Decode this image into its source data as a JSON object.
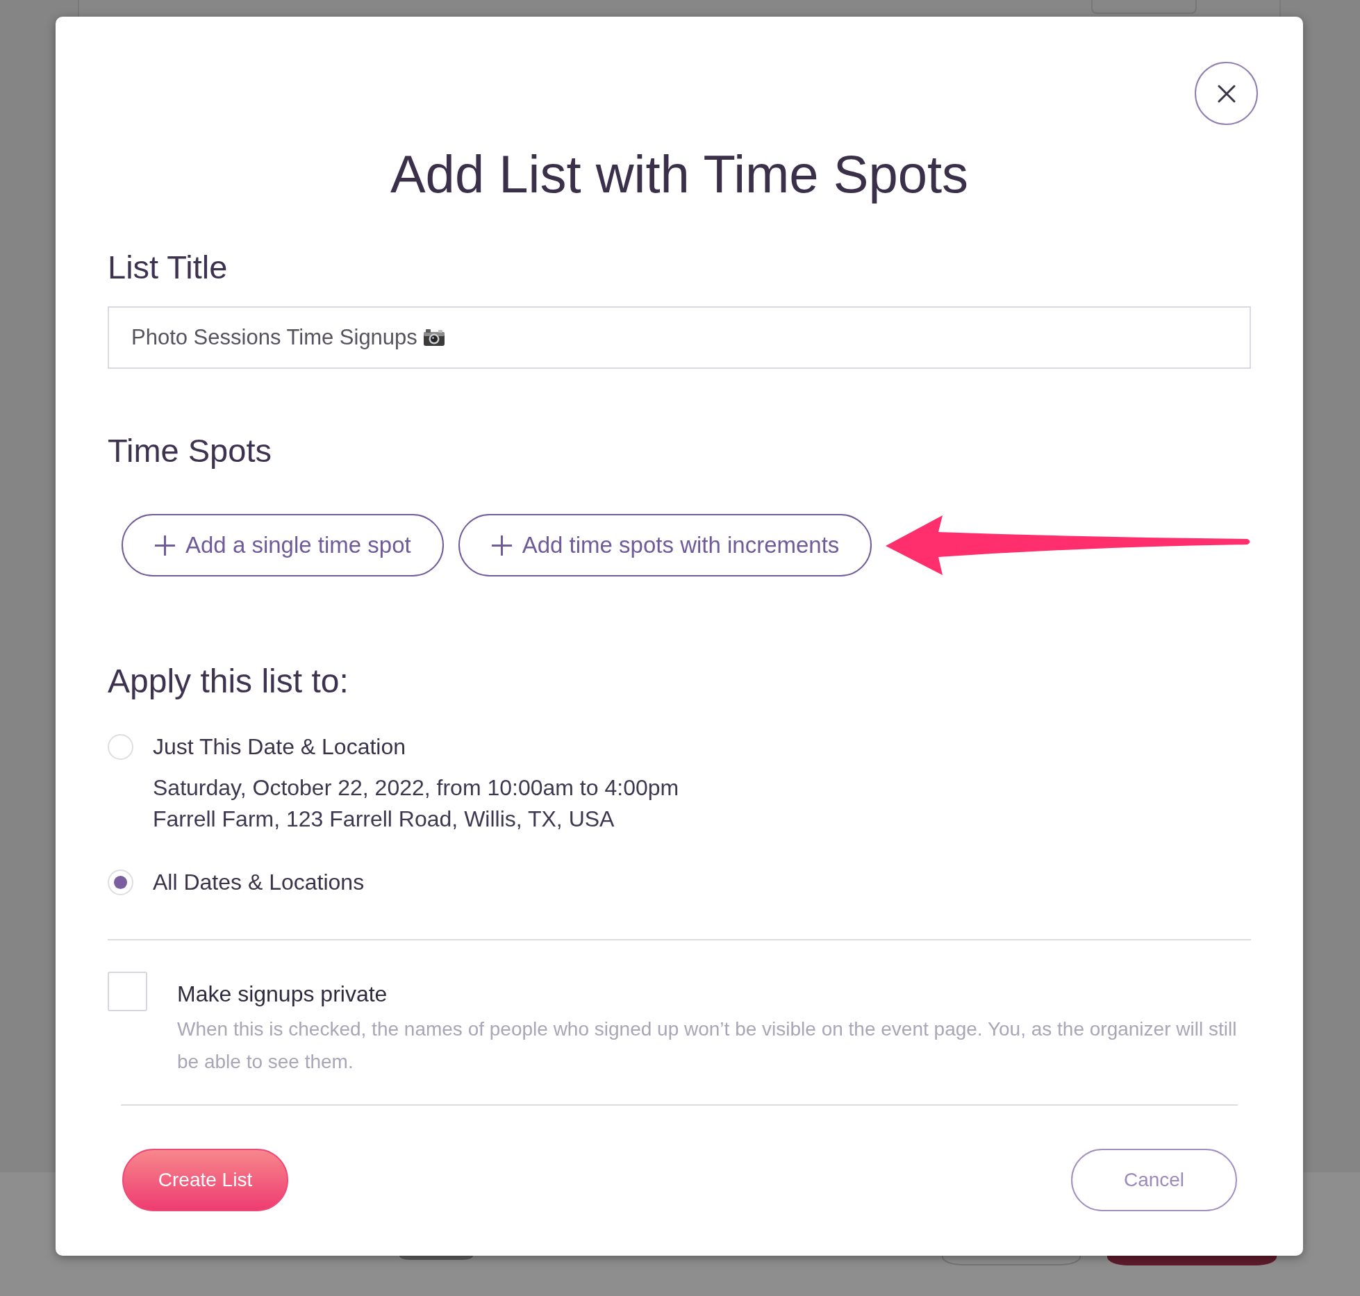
{
  "dialog": {
    "title": "Add List with Time Spots"
  },
  "list_title": {
    "label": "List Title",
    "value": "Photo Sessions Time Signups"
  },
  "time_spots": {
    "label": "Time Spots",
    "buttons": [
      {
        "label": "Add a single time spot"
      },
      {
        "label": "Add time spots with increments"
      }
    ]
  },
  "apply_to": {
    "label": "Apply this list to:",
    "options": [
      {
        "label": "Just This Date & Location",
        "details": [
          "Saturday, October 22, 2022, from 10:00am to 4:00pm",
          "Farrell Farm, 123 Farrell Road, Willis, TX, USA"
        ],
        "selected": false
      },
      {
        "label": "All Dates & Locations",
        "selected": true
      }
    ]
  },
  "privacy": {
    "label": "Make signups private",
    "description": "When this is checked, the names of people who signed up won’t be visible on the event page. You, as the organizer will still be able to see them.",
    "checked": false
  },
  "footer": {
    "buttons": [
      {
        "label": "Create List",
        "kind": "primary"
      },
      {
        "label": "Cancel",
        "kind": "secondary"
      }
    ]
  }
}
